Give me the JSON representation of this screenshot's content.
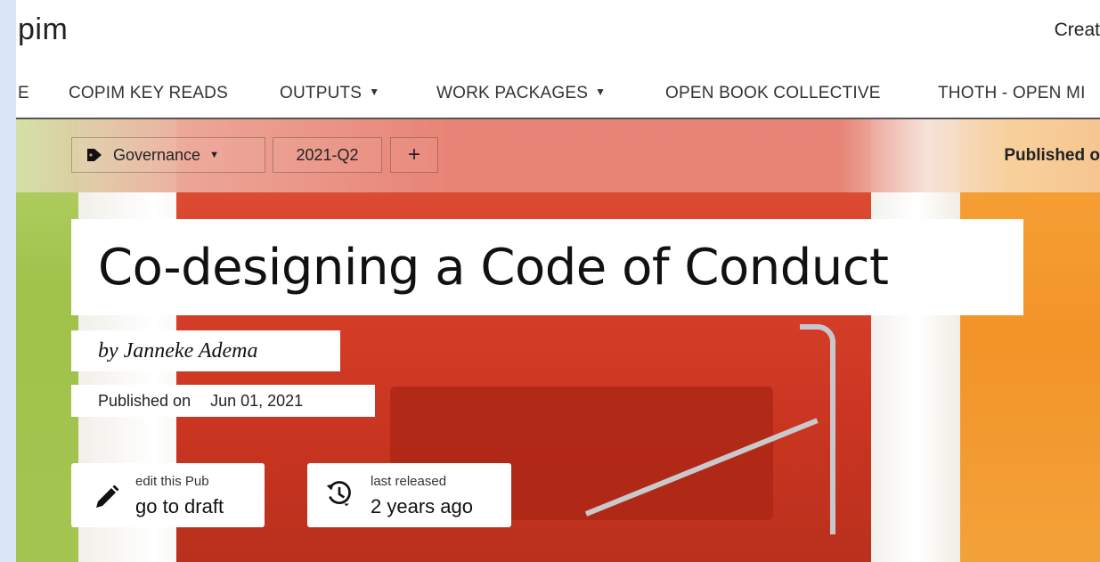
{
  "header": {
    "logo_text": "pim",
    "create_link": "Creat"
  },
  "nav": {
    "items": [
      {
        "label": "E",
        "dropdown": false
      },
      {
        "label": "COPIM KEY READS",
        "dropdown": false
      },
      {
        "label": "OUTPUTS",
        "dropdown": true
      },
      {
        "label": "WORK PACKAGES",
        "dropdown": true
      },
      {
        "label": "OPEN BOOK COLLECTIVE",
        "dropdown": false
      },
      {
        "label": "THOTH - OPEN MI",
        "dropdown": false
      }
    ]
  },
  "tags": {
    "collection_label": "Governance",
    "quarter_label": "2021-Q2",
    "add_label": "+",
    "published_top": "Published o"
  },
  "pub": {
    "title": "Co-designing a Code of Conduct",
    "byline": "by Janneke Adema",
    "published_label": "Published on",
    "published_date": "Jun 01, 2021"
  },
  "actions": {
    "edit_small": "edit this Pub",
    "edit_big": "go to draft",
    "release_small": "last released",
    "release_big": "2 years ago"
  },
  "colors": {
    "accent_band": "#e8877a",
    "sidebar_strip": "#d9e7f7"
  }
}
